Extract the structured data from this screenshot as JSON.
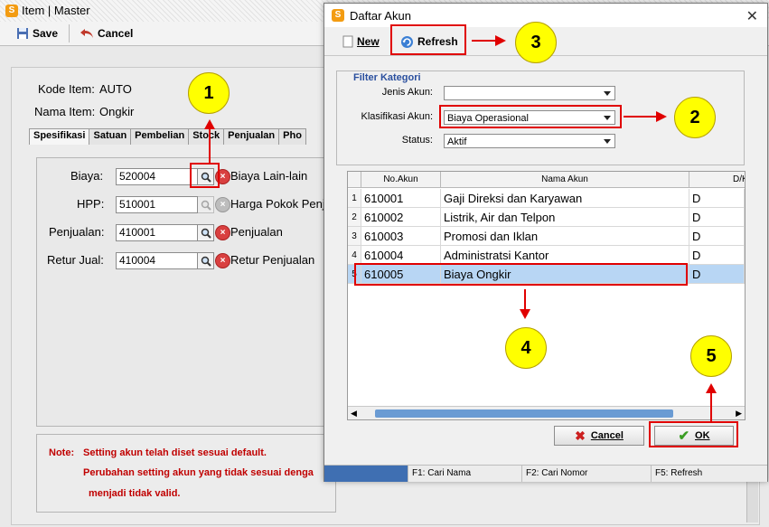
{
  "background_window": {
    "title": "Item | Master",
    "toolbar": {
      "save_label": "Save",
      "cancel_label": "Cancel"
    },
    "kode_item_label": "Kode Item:",
    "kode_item_value": "AUTO",
    "nama_item_label": "Nama Item:",
    "nama_item_value": "Ongkir",
    "tabs": [
      {
        "label": "Spesifikasi"
      },
      {
        "label": "Satuan"
      },
      {
        "label": "Pembelian"
      },
      {
        "label": "Stock"
      },
      {
        "label": "Penjualan"
      },
      {
        "label": "Pho"
      }
    ],
    "fields": [
      {
        "label": "Biaya:",
        "value": "520004",
        "desc": "Biaya Lain-lain"
      },
      {
        "label": "HPP:",
        "value": "510001",
        "desc": "Harga Pokok Penj"
      },
      {
        "label": "Penjualan:",
        "value": "410001",
        "desc": "Penjualan"
      },
      {
        "label": "Retur Jual:",
        "value": "410004",
        "desc": "Retur Penjualan"
      }
    ],
    "note_label": "Note:",
    "note_line1": "Setting akun telah diset sesuai default.",
    "note_line2": "Perubahan setting akun yang tidak sesuai denga",
    "note_line3": "menjadi tidak valid."
  },
  "dialog": {
    "title": "Daftar Akun",
    "close_glyph": "✕",
    "new_label": "New",
    "refresh_label": "Refresh",
    "filter_title": "Filter Kategori",
    "jenis_label": "Jenis Akun:",
    "jenis_value": "",
    "klasifikasi_label": "Klasifikasi Akun:",
    "klasifikasi_value": "Biaya Operasional",
    "status_label": "Status:",
    "status_value": "Aktif",
    "columns": [
      "No.Akun",
      "Nama Akun",
      "D/K"
    ],
    "rows": [
      {
        "n": "1",
        "no": "610001",
        "nama": "Gaji Direksi dan Karyawan",
        "dk": "D"
      },
      {
        "n": "2",
        "no": "610002",
        "nama": "Listrik, Air dan Telpon",
        "dk": "D"
      },
      {
        "n": "3",
        "no": "610003",
        "nama": "Promosi dan Iklan",
        "dk": "D"
      },
      {
        "n": "4",
        "no": "610004",
        "nama": "Administratsi Kantor",
        "dk": "D"
      },
      {
        "n": "5",
        "no": "610005",
        "nama": "Biaya Ongkir",
        "dk": "D"
      }
    ],
    "cancel_label": "Cancel",
    "ok_label": "OK",
    "status_bar": [
      "",
      "F1: Cari Nama",
      "F2: Cari Nomor",
      "F5: Refresh"
    ]
  },
  "callouts": [
    "1",
    "2",
    "3",
    "4",
    "5"
  ],
  "colors": {
    "annotation_red": "#e00000",
    "callout_yellow": "#ffff00",
    "selection_blue": "#b8d6f4",
    "note_red": "#c00000"
  }
}
